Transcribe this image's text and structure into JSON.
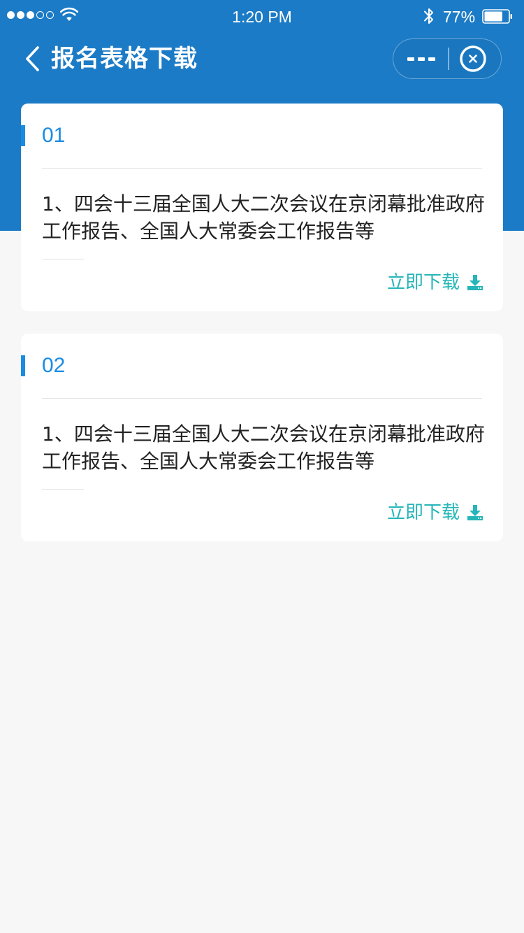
{
  "status_bar": {
    "time": "1:20 PM",
    "battery_percent": "77%",
    "signal_bars_filled": 3,
    "signal_bars_total": 5,
    "battery_level": 0.77
  },
  "nav": {
    "title": "报名表格下载",
    "back_icon": "chevron-left-icon",
    "more_icon": "more-icon",
    "close_icon": "close-circle-icon"
  },
  "cards": [
    {
      "number": "01",
      "text": "1、四会十三届全国人大二次会议在京闭幕批准政府工作报告、全国人大常委会工作报告等",
      "download_label": "立即下载"
    },
    {
      "number": "02",
      "text": "1、四会十三届全国人大二次会议在京闭幕批准政府工作报告、全国人大常委会工作报告等",
      "download_label": "立即下载"
    }
  ],
  "colors": {
    "header": "#1b7bc6",
    "accent": "#1a8be3",
    "download": "#26b5b8",
    "background": "#f7f7f7"
  }
}
